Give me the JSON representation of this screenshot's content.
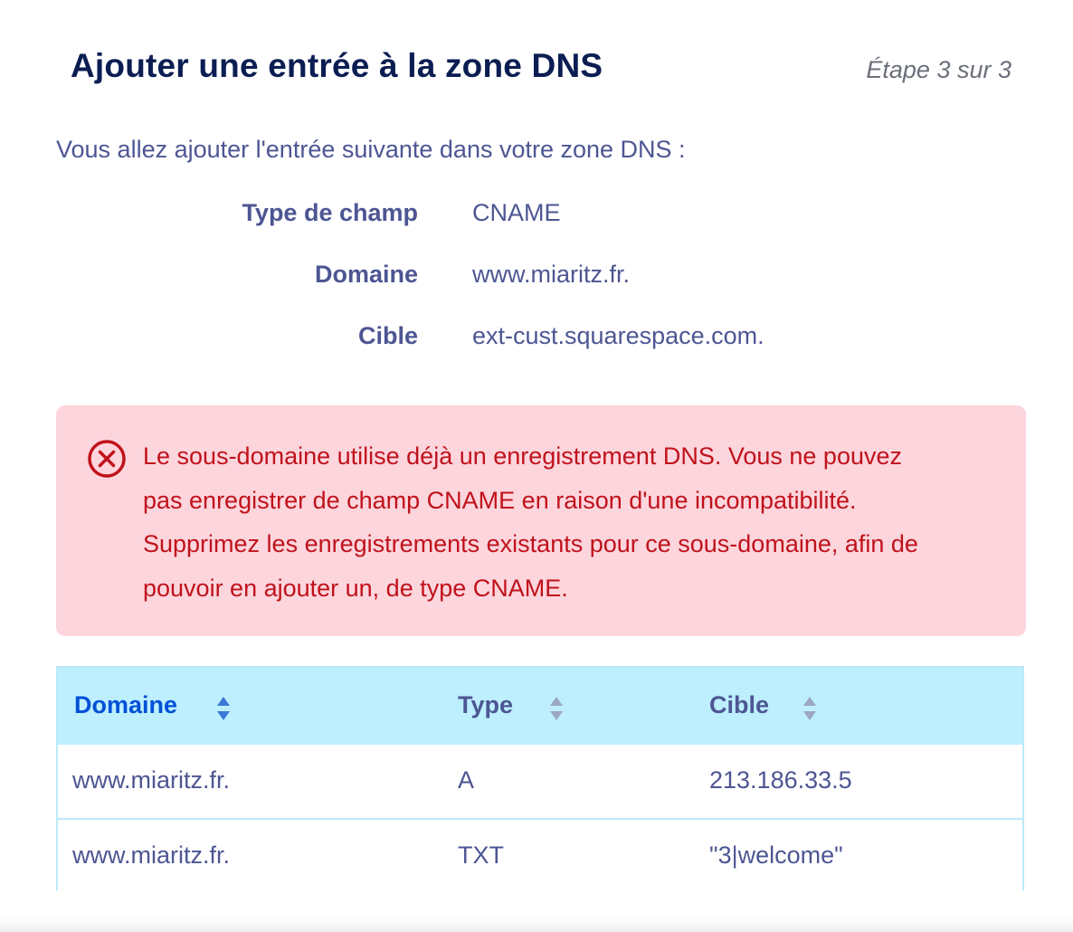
{
  "header": {
    "title": "Ajouter une entrée à la zone DNS",
    "step": "Étape 3 sur 3"
  },
  "intro": "Vous allez ajouter l'entrée suivante dans votre zone DNS :",
  "summary": {
    "type_label": "Type de champ",
    "type_value": "CNAME",
    "domain_label": "Domaine",
    "domain_value": "www.miaritz.fr.",
    "target_label": "Cible",
    "target_value": "ext-cust.squarespace.com."
  },
  "alert": {
    "icon": "error-circle-x-icon",
    "message": "Le sous-domaine utilise déjà un enregistrement DNS. Vous ne pouvez pas enregistrer de champ CNAME en raison d'une incompatibilité. Supprimez les enregistrements existants pour ce sous-domaine, afin de pouvoir en ajouter un, de type CNAME.",
    "color": "#c0121b",
    "background": "#fdd5dd"
  },
  "table": {
    "columns": [
      {
        "label": "Domaine",
        "sort_icon": "sort-icon"
      },
      {
        "label": "Type",
        "sort_icon": "sort-icon"
      },
      {
        "label": "Cible",
        "sort_icon": "sort-icon"
      }
    ],
    "rows": [
      {
        "domain": "www.miaritz.fr.",
        "type": "A",
        "target": "213.186.33.5"
      },
      {
        "domain": "www.miaritz.fr.",
        "type": "TXT",
        "target": "\"3|welcome\""
      }
    ]
  },
  "colors": {
    "title": "#0b1d52",
    "text": "#4d5693",
    "active_sort": "#0050d7",
    "table_header_bg": "#bdefff"
  }
}
